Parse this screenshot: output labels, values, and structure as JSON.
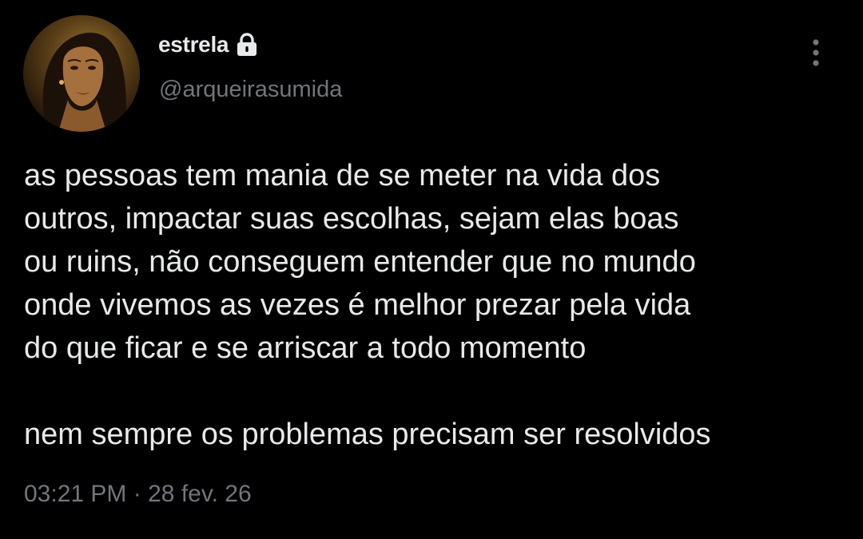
{
  "author": {
    "display_name": "estrela",
    "handle": "@arqueirasumida",
    "protected_icon": "lock-icon",
    "avatar": "profile-photo"
  },
  "menu": {
    "icon": "more-vertical-icon"
  },
  "tweet": {
    "paragraph1": [
      "as pessoas tem mania de se meter na vida dos",
      "outros, impactar suas escolhas, sejam elas boas",
      "ou ruins, não conseguem entender que no mundo",
      "onde vivemos as vezes é melhor prezar pela vida",
      "do que ficar e se arriscar a todo momento"
    ],
    "paragraph2": "nem sempre os problemas precisam ser resolvidos",
    "time": "03:21 PM",
    "separator": "·",
    "date": "28 fev. 26"
  },
  "colors": {
    "background": "#000000",
    "primary_text": "#e7e9ea",
    "secondary_text": "#71767b"
  }
}
